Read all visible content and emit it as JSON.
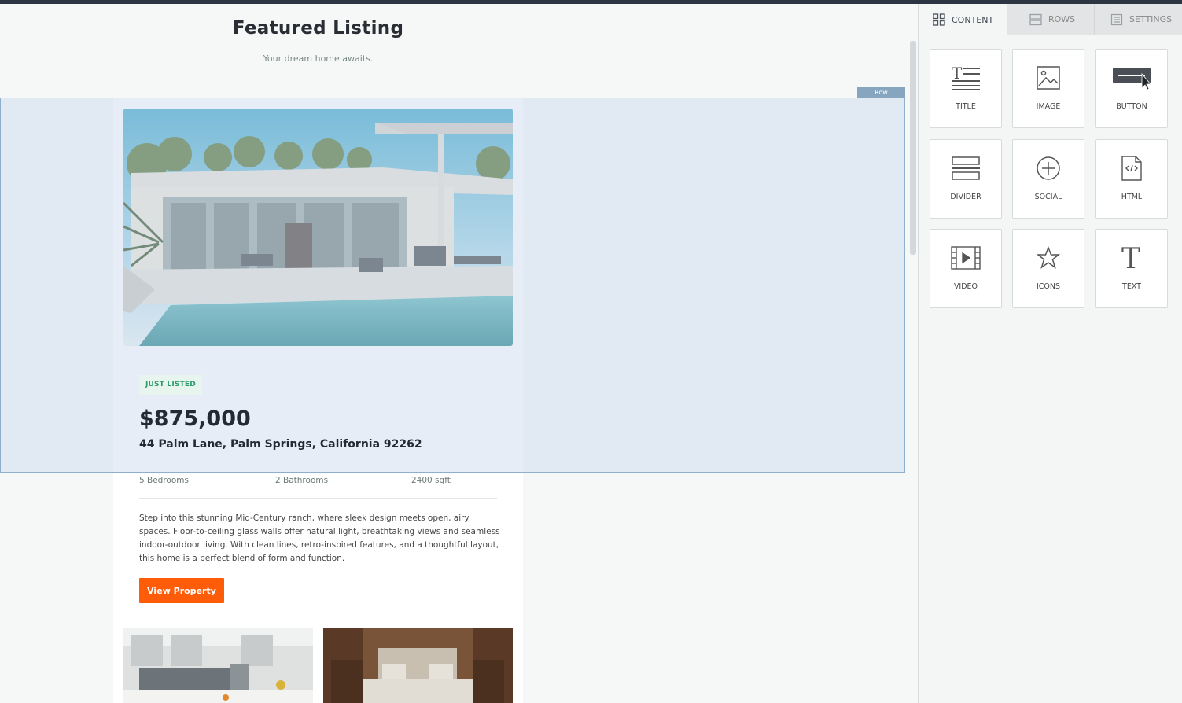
{
  "canvas": {
    "title": "Featured Listing",
    "subtitle": "Your dream home awaits.",
    "row_tag": "Row",
    "listing": {
      "badge": "JUST LISTED",
      "price": "$875,000",
      "address": "44 Palm Lane, Palm Springs, California 92262",
      "bedrooms": "5 Bedrooms",
      "bathrooms": "2 Bathrooms",
      "area": "2400 sqft",
      "description": "Step into this stunning Mid-Century ranch, where sleek design meets open, airy spaces. Floor-to-ceiling glass walls offer natural light, breathtaking views and seamless indoor-outdoor living. With clean lines, retro-inspired features, and a thoughtful layout, this home is a perfect blend of form and function.",
      "cta_label": "View Property"
    },
    "colors": {
      "cta": "#ff5c0a",
      "badge_text": "#2b9a6a",
      "row_highlight": "#c8d8ec"
    }
  },
  "panel": {
    "tabs": [
      {
        "label": "CONTENT",
        "icon": "grid-icon",
        "active": true
      },
      {
        "label": "ROWS",
        "icon": "rows-icon",
        "active": false
      },
      {
        "label": "SETTINGS",
        "icon": "settings-icon",
        "active": false
      }
    ],
    "blocks": [
      {
        "label": "TITLE",
        "icon": "title-icon"
      },
      {
        "label": "IMAGE",
        "icon": "image-icon"
      },
      {
        "label": "BUTTON",
        "icon": "button-icon"
      },
      {
        "label": "DIVIDER",
        "icon": "divider-icon"
      },
      {
        "label": "SOCIAL",
        "icon": "social-icon"
      },
      {
        "label": "HTML",
        "icon": "html-icon"
      },
      {
        "label": "VIDEO",
        "icon": "video-icon"
      },
      {
        "label": "ICONS",
        "icon": "star-icon"
      },
      {
        "label": "TEXT",
        "icon": "text-icon"
      }
    ]
  }
}
